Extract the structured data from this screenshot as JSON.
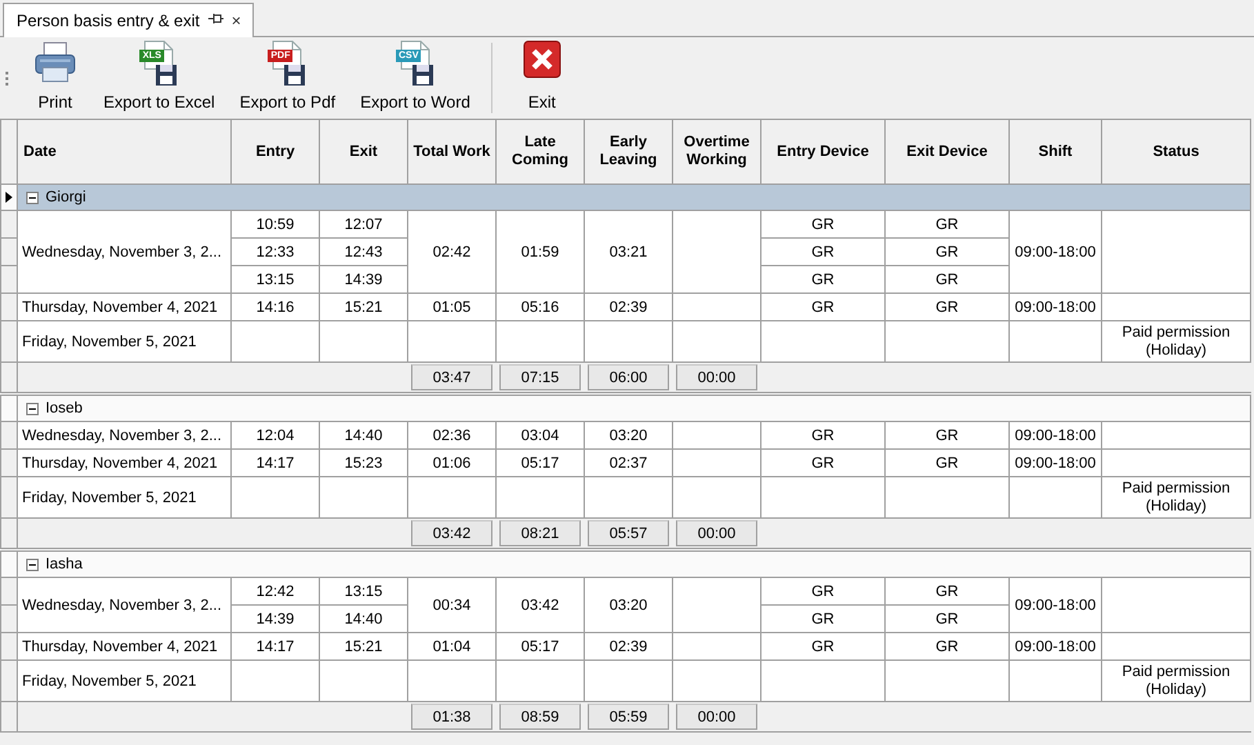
{
  "tab": {
    "title": "Person basis entry & exit",
    "pinned": true,
    "close": "×"
  },
  "toolbar": [
    {
      "kind": "print",
      "label": "Print"
    },
    {
      "kind": "excel",
      "badge": "XLS",
      "label": "Export to Excel"
    },
    {
      "kind": "pdf",
      "badge": "PDF",
      "label": "Export to Pdf"
    },
    {
      "kind": "csv",
      "badge": "CSV",
      "label": "Export to Word"
    },
    {
      "kind": "exit",
      "label": "Exit"
    }
  ],
  "columns": [
    "Date",
    "Entry",
    "Exit",
    "Total Work",
    "Late Coming",
    "Early Leaving",
    "Overtime Working",
    "Entry Device",
    "Exit Device",
    "Shift",
    "Status"
  ],
  "groups": [
    {
      "name": "Giorgi",
      "expanded": true,
      "selected": true,
      "days": [
        {
          "date": "Wednesday, November 3, 2...",
          "punches": [
            {
              "entry": "10:59",
              "exit": "12:07",
              "entry_device": "GR",
              "exit_device": "GR"
            },
            {
              "entry": "12:33",
              "exit": "12:43",
              "entry_device": "GR",
              "exit_device": "GR"
            },
            {
              "entry": "13:15",
              "exit": "14:39",
              "entry_device": "GR",
              "exit_device": "GR"
            }
          ],
          "total_work": "02:42",
          "late_coming": "01:59",
          "early_leaving": "03:21",
          "shift": "09:00-18:00"
        },
        {
          "date": "Thursday, November 4, 2021",
          "punches": [
            {
              "entry": "14:16",
              "exit": "15:21",
              "entry_device": "GR",
              "exit_device": "GR"
            }
          ],
          "total_work": "01:05",
          "late_coming": "05:16",
          "early_leaving": "02:39",
          "shift": "09:00-18:00"
        },
        {
          "date": "Friday, November 5, 2021",
          "status": "Paid permission (Holiday)"
        }
      ],
      "totals": [
        "03:47",
        "07:15",
        "06:00",
        "00:00"
      ]
    },
    {
      "name": "Ioseb",
      "expanded": true,
      "selected": false,
      "days": [
        {
          "date": "Wednesday, November 3, 2...",
          "punches": [
            {
              "entry": "12:04",
              "exit": "14:40",
              "entry_device": "GR",
              "exit_device": "GR"
            }
          ],
          "total_work": "02:36",
          "late_coming": "03:04",
          "early_leaving": "03:20",
          "shift": "09:00-18:00"
        },
        {
          "date": "Thursday, November 4, 2021",
          "punches": [
            {
              "entry": "14:17",
              "exit": "15:23",
              "entry_device": "GR",
              "exit_device": "GR"
            }
          ],
          "total_work": "01:06",
          "late_coming": "05:17",
          "early_leaving": "02:37",
          "shift": "09:00-18:00"
        },
        {
          "date": "Friday, November 5, 2021",
          "status": "Paid permission (Holiday)"
        }
      ],
      "totals": [
        "03:42",
        "08:21",
        "05:57",
        "00:00"
      ]
    },
    {
      "name": "Iasha",
      "expanded": true,
      "selected": false,
      "days": [
        {
          "date": "Wednesday, November 3, 2...",
          "punches": [
            {
              "entry": "12:42",
              "exit": "13:15",
              "entry_device": "GR",
              "exit_device": "GR"
            },
            {
              "entry": "14:39",
              "exit": "14:40",
              "entry_device": "GR",
              "exit_device": "GR"
            }
          ],
          "total_work": "00:34",
          "late_coming": "03:42",
          "early_leaving": "03:20",
          "shift": "09:00-18:00"
        },
        {
          "date": "Thursday, November 4, 2021",
          "punches": [
            {
              "entry": "14:17",
              "exit": "15:21",
              "entry_device": "GR",
              "exit_device": "GR"
            }
          ],
          "total_work": "01:04",
          "late_coming": "05:17",
          "early_leaving": "02:39",
          "shift": "09:00-18:00"
        },
        {
          "date": "Friday, November 5, 2021",
          "status": "Paid permission (Holiday)"
        }
      ],
      "totals": [
        "01:38",
        "08:59",
        "05:59",
        "00:00"
      ]
    }
  ]
}
